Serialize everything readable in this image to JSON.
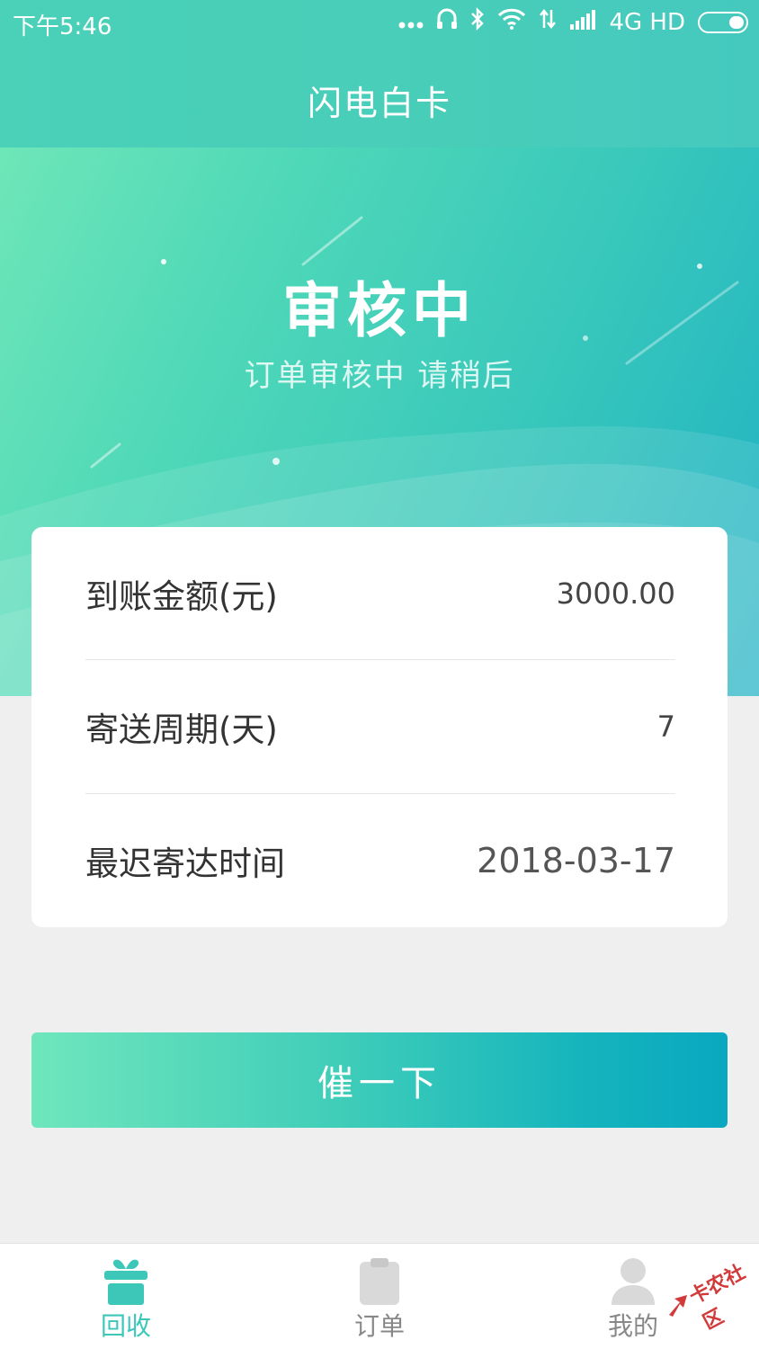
{
  "status_bar": {
    "time": "下午5:46",
    "network": "4G HD",
    "icons": [
      "more-dots-icon",
      "headphone-icon",
      "bluetooth-icon",
      "wifi-icon",
      "data-arrows-icon",
      "signal-icon",
      "battery-icon"
    ]
  },
  "header": {
    "title": "闪电白卡"
  },
  "hero": {
    "status_title": "审核中",
    "status_subtitle": "订单审核中 请稍后"
  },
  "details": {
    "rows": [
      {
        "label": "到账金额(元)",
        "value": "3000.00"
      },
      {
        "label": "寄送周期(天)",
        "value": "7"
      },
      {
        "label": "最迟寄达时间",
        "value": "2018-03-17"
      }
    ]
  },
  "action": {
    "urge_label": "催一下"
  },
  "tabbar": {
    "tabs": [
      {
        "label": "回收",
        "icon": "gift-box-icon",
        "active": true
      },
      {
        "label": "订单",
        "icon": "clipboard-icon",
        "active": false
      },
      {
        "label": "我的",
        "icon": "user-icon",
        "active": false
      }
    ]
  },
  "watermark": {
    "text": "卡农社区"
  },
  "colors": {
    "accent": "#3cc7b9",
    "hero_start": "#6ee6b8",
    "hero_end": "#1fb1c4",
    "button_end": "#0aa8c0",
    "inactive_icon": "#d9d9d9"
  }
}
